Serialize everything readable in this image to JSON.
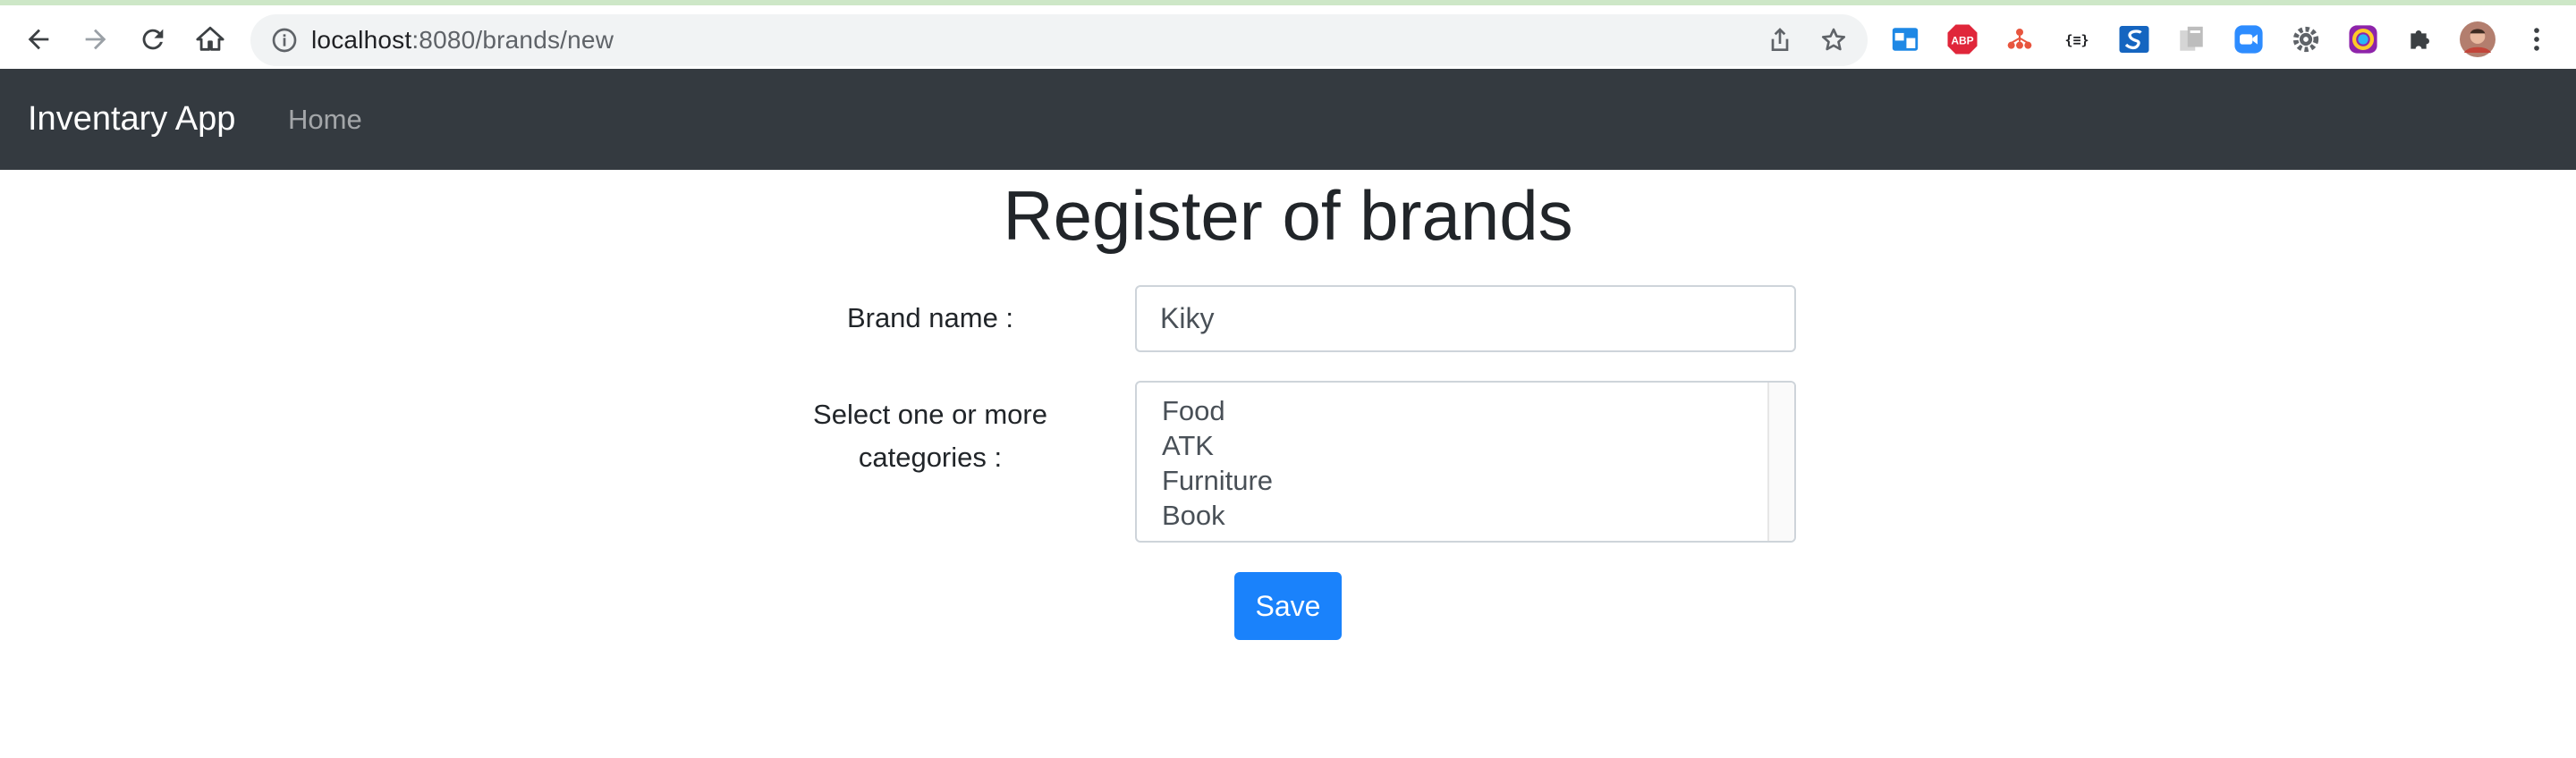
{
  "browser": {
    "url_host": "localhost",
    "url_rest": ":8080/brands/new",
    "extensions": [
      "window-ext-icon",
      "adblock-plus-icon",
      "network-ext-icon",
      "json-viewer-icon",
      "s-ext-icon",
      "document-ext-icon",
      "zoom-icon",
      "gear-ext-icon",
      "color-picker-icon",
      "puzzle-icon",
      "profile-avatar",
      "kebab-menu-icon"
    ],
    "abp_label": "ABP",
    "json_label": "{≡}"
  },
  "navbar": {
    "brand": "Inventary App",
    "home": "Home"
  },
  "page": {
    "title": "Register of brands",
    "brand_label": "Brand name :",
    "brand_value": "Kiky",
    "categories_label_line1": "Select one or more",
    "categories_label_line2": "categories :",
    "categories": [
      "Food",
      "ATK",
      "Furniture",
      "Book"
    ],
    "save": "Save"
  },
  "colors": {
    "navbar_bg": "#343a40",
    "primary": "#1a82fb"
  }
}
